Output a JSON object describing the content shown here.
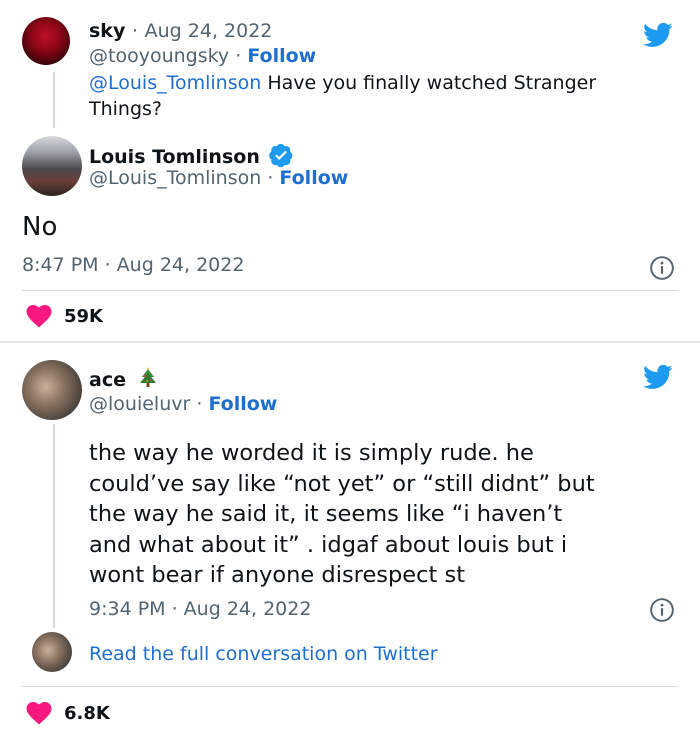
{
  "colors": {
    "link": "#1d6fd0",
    "twitter_blue": "#1d9bf0",
    "heart": "#f91880",
    "muted_text": "#536471"
  },
  "card1": {
    "reply": {
      "name": "sky",
      "date_separator": "·",
      "date": "Aug 24, 2022",
      "handle": "@tooyoungsky",
      "follow_separator": "·",
      "follow": "Follow",
      "mention": "@Louis_Tomlinson",
      "text_line1": " Have you finally watched Stranger",
      "text_line2": "Things?"
    },
    "main": {
      "name": "Louis Tomlinson",
      "verified_icon": "verified-badge-icon",
      "handle": "@Louis_Tomlinson",
      "follow_separator": "·",
      "follow": "Follow",
      "text": "No",
      "timestamp": "8:47 PM · Aug 24, 2022",
      "likes": "59K"
    }
  },
  "card2": {
    "main": {
      "name": "ace",
      "emoji_icon": "christmas-tree-icon",
      "handle": "@louieluvr",
      "follow_separator": "·",
      "follow": "Follow",
      "text_lines": [
        "the way he worded it is simply rude. he",
        "could’ve say like “not yet” or “still didnt” but",
        "the way he said it, it seems like “i haven’t",
        "and what about it” . idgaf about louis but i",
        "wont bear if anyone disrespect st"
      ],
      "timestamp": "9:34 PM · Aug 24, 2022",
      "read_more": "Read the full conversation on Twitter",
      "likes": "6.8K"
    }
  }
}
